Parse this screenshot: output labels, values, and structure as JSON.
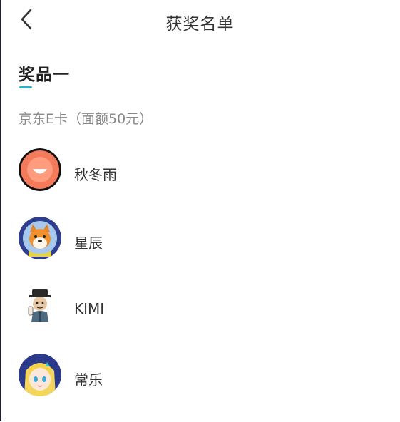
{
  "header": {
    "title": "获奖名单",
    "back_icon": "chevron-left-icon"
  },
  "prize": {
    "tab_label": "奖品一",
    "description": "京东E卡（面额50元）",
    "accent_color": "#25b3c7"
  },
  "winners": [
    {
      "name": "秋冬雨",
      "avatar": "orange-smiley-avatar"
    },
    {
      "name": "星辰",
      "avatar": "shiba-dog-astronaut-avatar"
    },
    {
      "name": "KIMI",
      "avatar": "cartoon-scholar-avatar"
    },
    {
      "name": "常乐",
      "avatar": "anime-girl-avatar"
    }
  ]
}
